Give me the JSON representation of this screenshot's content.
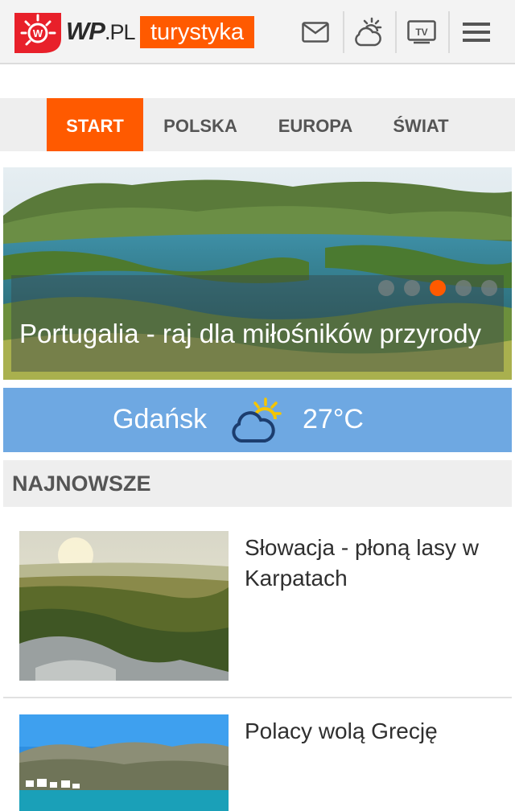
{
  "header": {
    "brand_main": "WP",
    "brand_suffix": ".PL",
    "section": "turystyka",
    "icons": [
      "mail-icon",
      "weather-icon",
      "tv-icon",
      "menu-icon"
    ],
    "tv_text": "TV",
    "colors": {
      "accent": "#ff5a00",
      "logo_red": "#e8202a"
    }
  },
  "nav": {
    "tabs": [
      {
        "label": "START",
        "active": true
      },
      {
        "label": "POLSKA",
        "active": false
      },
      {
        "label": "EUROPA",
        "active": false
      },
      {
        "label": "ŚWIAT",
        "active": false
      }
    ]
  },
  "hero": {
    "title": "Portugalia - raj dla miłośników przyrody",
    "slides_total": 5,
    "active_slide": 3
  },
  "weather": {
    "city": "Gdańsk",
    "temperature": "27°C",
    "condition_icon": "partly-cloudy-icon",
    "background": "#6ea8e2"
  },
  "latest": {
    "heading": "NAJNOWSZE",
    "articles": [
      {
        "title": "Słowacja - płoną lasy w Karpatach",
        "image": "landscape-photo"
      },
      {
        "title": "Polacy wolą Grecję",
        "image": "coast-photo"
      }
    ]
  }
}
